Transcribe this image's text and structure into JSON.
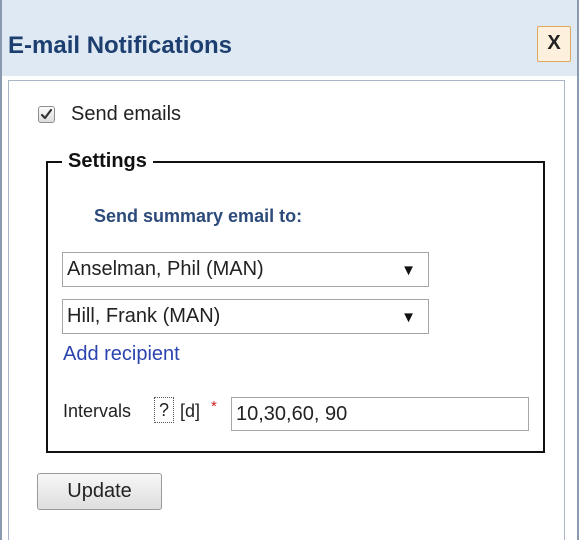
{
  "dialog": {
    "title": "E-mail Notifications",
    "close_label": "X"
  },
  "send_emails": {
    "checked": true,
    "label": "Send emails"
  },
  "settings": {
    "legend": "Settings",
    "summary_label": "Send summary email to:",
    "recipients": [
      {
        "value": "Anselman, Phil (MAN)"
      },
      {
        "value": "Hill, Frank (MAN)"
      }
    ],
    "add_recipient_label": "Add recipient",
    "intervals": {
      "label": "Intervals",
      "help": "?",
      "unit": "[d]",
      "required_mark": "*",
      "value": "10,30,60, 90"
    }
  },
  "actions": {
    "update_label": "Update"
  },
  "colors": {
    "title_bar": "#dfe9f4",
    "title_text": "#1d3f70",
    "link": "#2b43b0",
    "required": "#d32020"
  }
}
